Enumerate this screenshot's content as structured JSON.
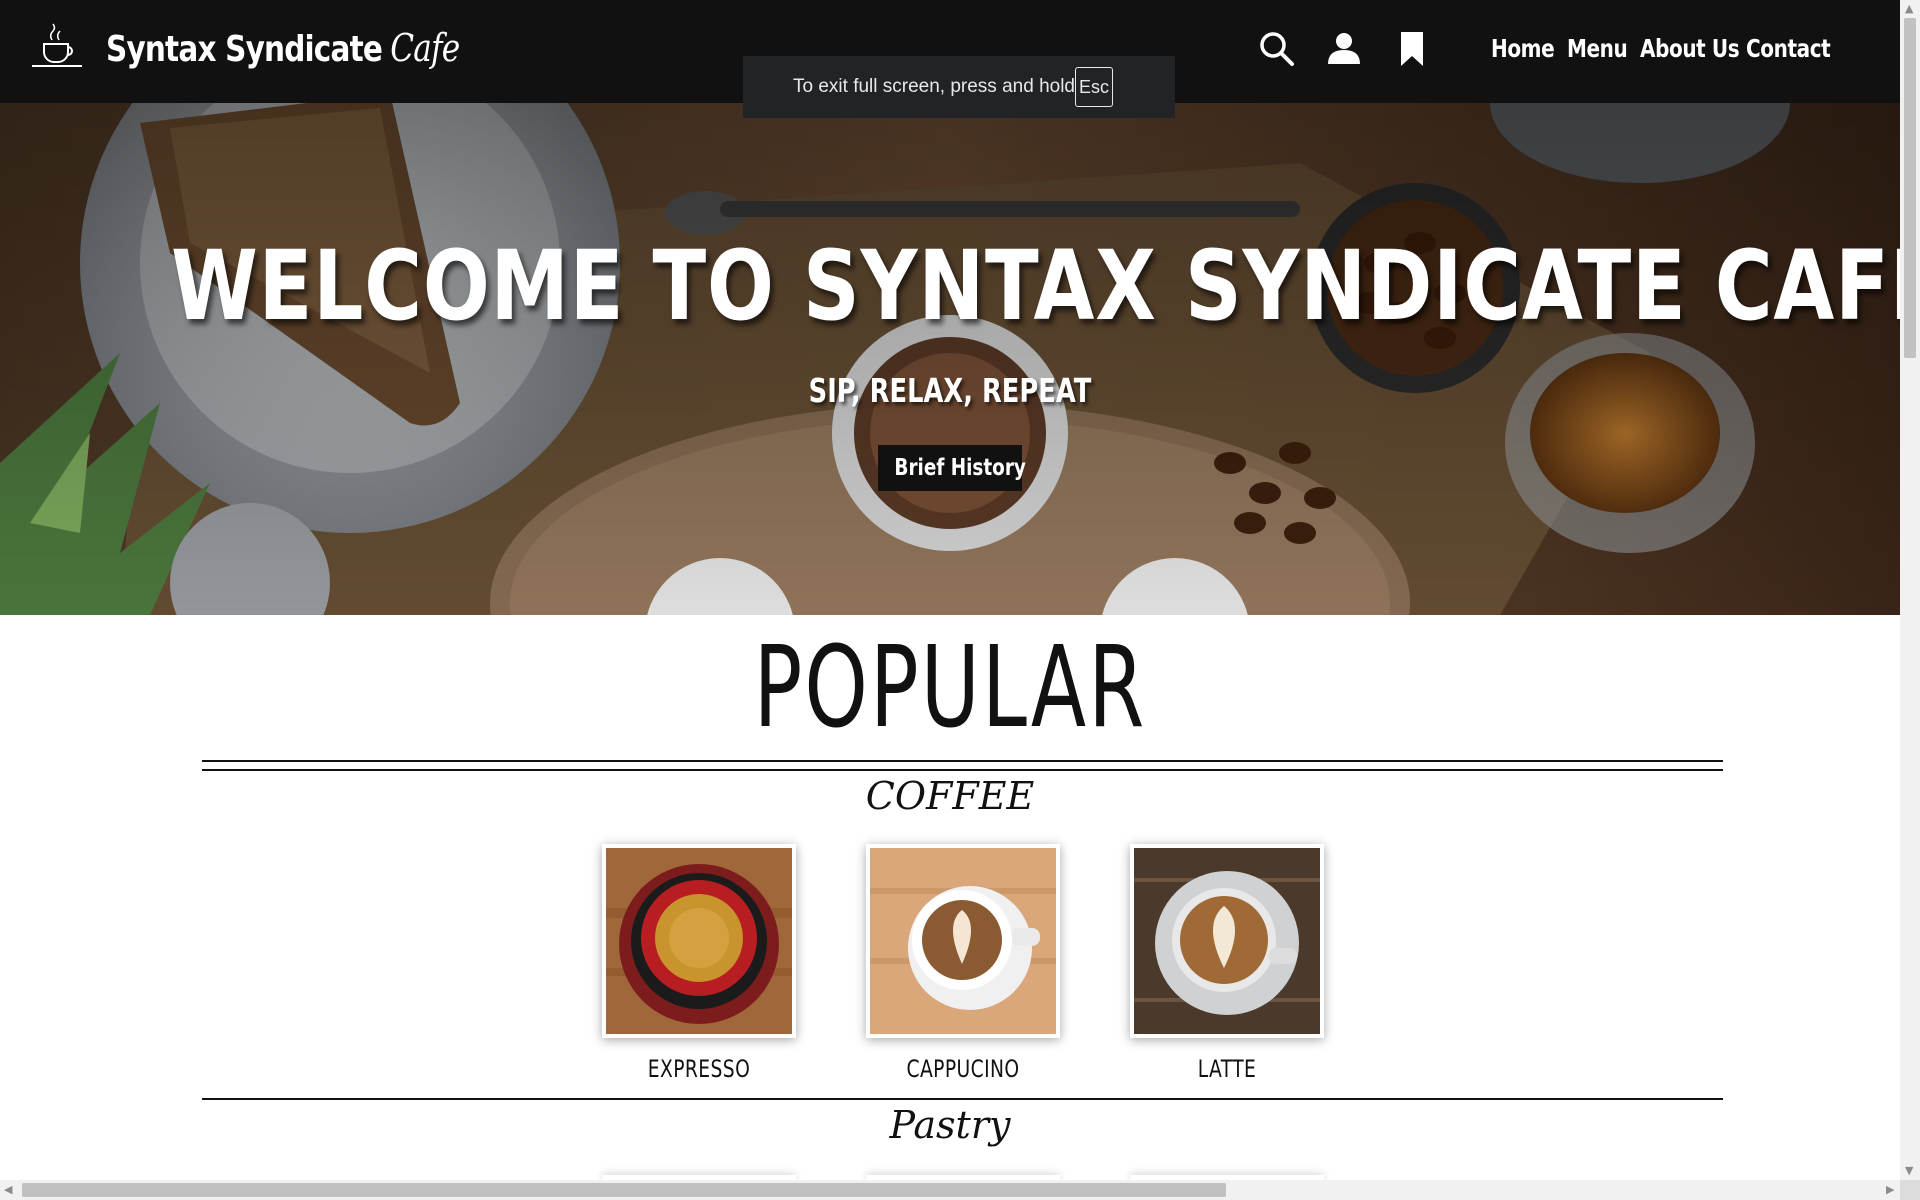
{
  "header": {
    "brand": "Syntax Syndicate",
    "brand_script": "Cafe",
    "icons": [
      "cafe-logo-icon",
      "search-icon",
      "user-icon",
      "bookmark-icon"
    ],
    "nav": [
      "Home",
      "Menu",
      "About Us",
      "Contact"
    ]
  },
  "toast": {
    "message": "To exit full screen, press and hold",
    "key": "Esc"
  },
  "hero": {
    "title": "WELCOME TO SYNTAX SYNDICATE CAFE",
    "subtitle": "SIP, RELAX, REPEAT",
    "button": "Brief History"
  },
  "popular": {
    "title": "POPULAR",
    "coffee_title": "COFFEE",
    "coffee_items": [
      "EXPRESSO",
      "CAPPUCINO",
      "LATTE"
    ],
    "pastry_title": "Pastry"
  },
  "colors": {
    "header_bg": "#111111",
    "toast_bg": "#222326",
    "button_bg": "#111111",
    "page_bg": "#ffffff"
  }
}
